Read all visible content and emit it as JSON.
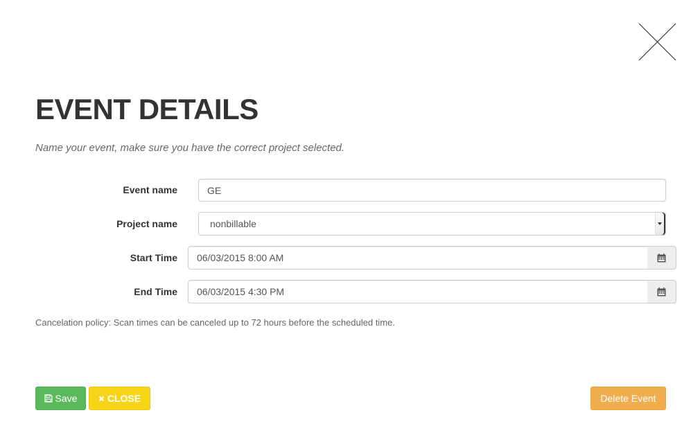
{
  "modal": {
    "title": "EVENT DETAILS",
    "subtitle": "Name your event, make sure you have the correct project selected."
  },
  "form": {
    "event_name": {
      "label": "Event name",
      "value": "GE"
    },
    "project_name": {
      "label": "Project name",
      "selected": "nonbillable"
    },
    "start_time": {
      "label": "Start Time",
      "value": "06/03/2015 8:00 AM"
    },
    "end_time": {
      "label": "End Time",
      "value": "06/03/2015 4:30 PM"
    }
  },
  "policy_text": "Cancelation policy: Scan times can be canceled up to 72 hours before the scheduled time.",
  "buttons": {
    "save_label": "Save",
    "close_label": "CLOSE",
    "delete_label": "Delete Event"
  },
  "icons": {
    "close": "close-x-icon",
    "calendar": "calendar-icon",
    "save": "floppy-disk-icon",
    "close_small": "x-icon"
  },
  "colors": {
    "save": "#5cb85c",
    "close": "#f7d417",
    "delete": "#f0ad4e"
  }
}
